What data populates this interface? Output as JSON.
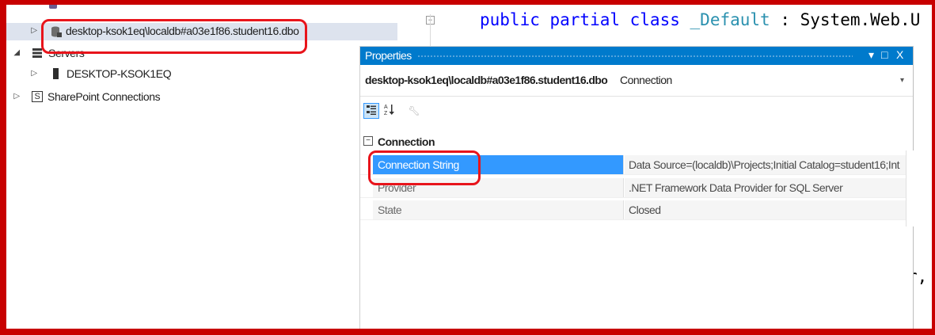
{
  "tree": {
    "selected_node": "desktop-ksok1eq\\localdb#a03e1f86.student16.dbo",
    "servers_label": "Servers",
    "server_node": "DESKTOP-KSOK1EQ",
    "sharepoint_label": "SharePoint Connections"
  },
  "code": {
    "line1_keywords": "public partial class",
    "line1_class": "_Default",
    "line1_rest": " : System.Web.U",
    "line2_fragment": "r,"
  },
  "properties": {
    "title": "Properties",
    "window_buttons": {
      "dropdown": "▾",
      "maximize": "□",
      "close": "X"
    },
    "object_name": "desktop-ksok1eq\\localdb#a03e1f86.student16.dbo",
    "object_type": "Connection",
    "category": "Connection",
    "rows": [
      {
        "name": "Connection String",
        "value": "Data Source=(localdb)\\Projects;Initial Catalog=student16;Int"
      },
      {
        "name": "Provider",
        "value": ".NET Framework Data Provider for SQL Server"
      },
      {
        "name": "State",
        "value": "Closed"
      }
    ]
  },
  "colors": {
    "frame": "#c80000",
    "annotation": "#e8141b",
    "title_bar": "#007acc",
    "selection": "#3399ff"
  }
}
